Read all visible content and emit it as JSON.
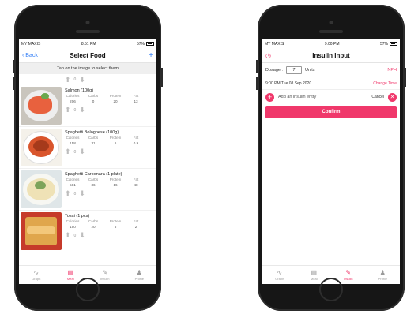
{
  "left_screen": {
    "status": {
      "carrier": "MY MAXIS",
      "time": "8:51 PM",
      "battery": "57%"
    },
    "nav": {
      "back_label": "Back",
      "title": "Select Food",
      "add_icon": "+"
    },
    "hint": "Tap on the image to select them",
    "top_qty": "0",
    "nutrient_headers": [
      "Calories",
      "Carbs",
      "Protein",
      "Fat"
    ],
    "foods": [
      {
        "name": "Salmon (100g)",
        "calories": "206",
        "carbs": "0",
        "protein": "20",
        "fat": "13",
        "qty": "0"
      },
      {
        "name": "Spaghetti Bolognese (100g)",
        "calories": "158",
        "carbs": "31",
        "protein": "6",
        "fat": "0.9",
        "qty": "0"
      },
      {
        "name": "Spaghetti Carbonara (1 plate)",
        "calories": "581",
        "carbs": "36",
        "protein": "16",
        "fat": "48",
        "qty": "0"
      },
      {
        "name": "Tosai (1 pcs)",
        "calories": "150",
        "carbs": "20",
        "protein": "5",
        "fat": "2",
        "qty": "0"
      }
    ]
  },
  "right_screen": {
    "status": {
      "carrier": "MY MAXIS",
      "time": "9:00 PM",
      "battery": "57%"
    },
    "nav": {
      "title": "Insulin Input"
    },
    "dosage": {
      "label": "Dosage :",
      "value": "7",
      "units": "Units",
      "type": "NPH"
    },
    "time_row": {
      "datetime": "9:00 PM Tue 08 Sep 2020",
      "change_label": "Change Time"
    },
    "add_entry": {
      "label": "Add an insulin entry",
      "cancel_label": "Cancel"
    },
    "confirm_label": "Confirm"
  },
  "tabs": [
    {
      "label": "Graph",
      "icon": "graph-icon"
    },
    {
      "label": "Meal",
      "icon": "meal-icon"
    },
    {
      "label": "Insulin",
      "icon": "syringe-icon"
    },
    {
      "label": "Profile",
      "icon": "profile-icon"
    }
  ],
  "colors": {
    "accent": "#f0386b",
    "link": "#2f7cf6"
  }
}
